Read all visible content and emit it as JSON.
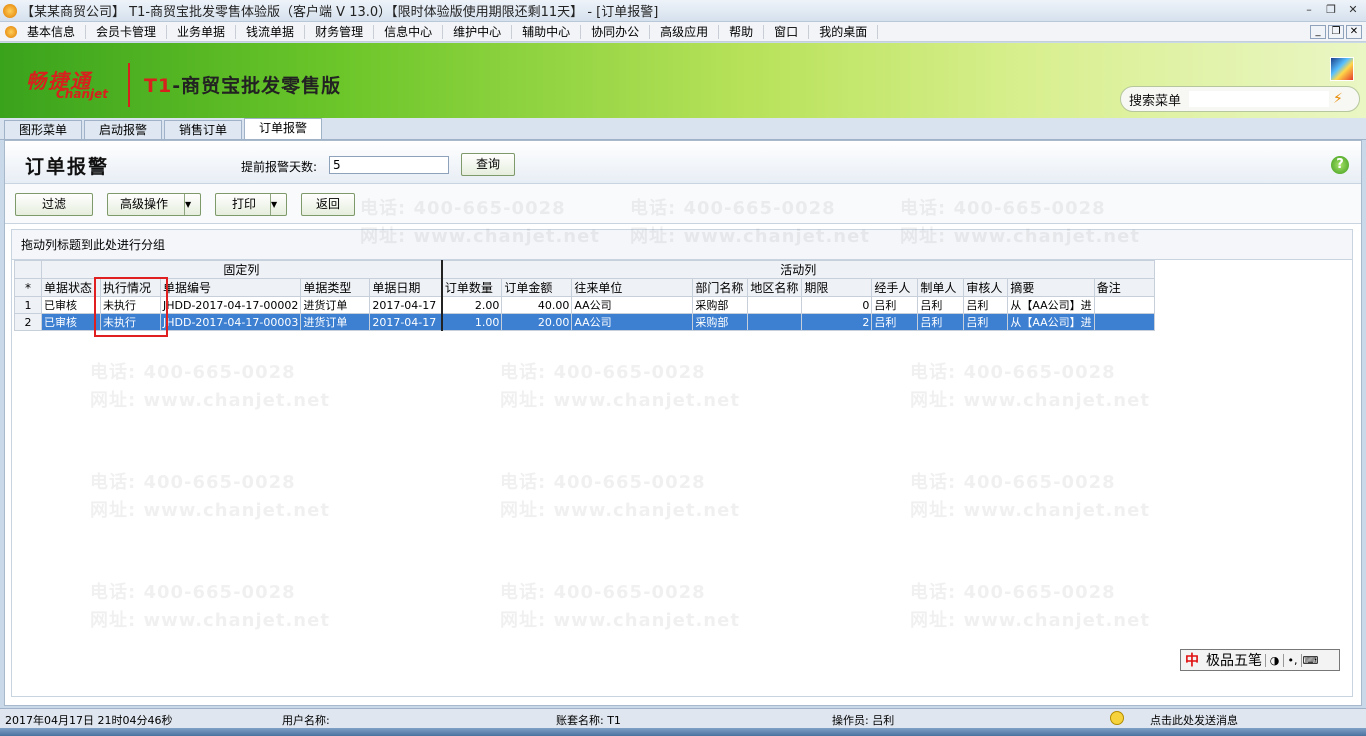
{
  "window": {
    "title": "【某某商贸公司】 T1-商贸宝批发零售体验版（客户端 V 13.0）【限时体验版使用期限还剩11天】 - [订单报警]",
    "controls": [
      "–",
      "❐",
      "✕"
    ]
  },
  "menu": [
    "基本信息",
    "会员卡管理",
    "业务单据",
    "钱流单据",
    "财务管理",
    "信息中心",
    "维护中心",
    "辅助中心",
    "协同办公",
    "高级应用",
    "帮助",
    "窗口",
    "我的桌面"
  ],
  "mdi_controls": [
    "_",
    "❐",
    "✕"
  ],
  "banner": {
    "brand_cn": "畅捷通",
    "brand_en": "Chanjet",
    "product_prefix": "T1",
    "product_rest": "-商贸宝批发零售版"
  },
  "search": {
    "label": "搜索菜单",
    "value": ""
  },
  "tabs": [
    {
      "label": "图形菜单",
      "active": false
    },
    {
      "label": "启动报警",
      "active": false
    },
    {
      "label": "销售订单",
      "active": false
    },
    {
      "label": "订单报警",
      "active": true
    }
  ],
  "page": {
    "title": "订单报警",
    "days_label": "提前报警天数:",
    "days_value": "5",
    "query_button": "查询"
  },
  "toolbar": {
    "filter": "过滤",
    "advanced": "高级操作",
    "print": "打印",
    "back": "返回"
  },
  "group_hint": "拖动列标题到此处进行分组",
  "grid": {
    "fixed_group": "固定列",
    "active_group": "活动列",
    "row_marker": "*",
    "columns": [
      "单据状态",
      "执行情况",
      "单据编号",
      "单据类型",
      "单据日期",
      "订单数量",
      "订单金额",
      "往来单位",
      "部门名称",
      "地区名称",
      "期限",
      "经手人",
      "制单人",
      "审核人",
      "摘要",
      "备注"
    ],
    "rows": [
      {
        "no": "1",
        "cells": [
          "已审核",
          "未执行",
          "JHDD-2017-04-17-00002",
          "进货订单",
          "2017-04-17",
          "2.00",
          "40.00",
          "AA公司",
          "采购部",
          "",
          "0",
          "吕利",
          "吕利",
          "吕利",
          "从【AA公司】进",
          ""
        ],
        "selected": false
      },
      {
        "no": "2",
        "cells": [
          "已审核",
          "未执行",
          "JHDD-2017-04-17-00003",
          "进货订单",
          "2017-04-17",
          "1.00",
          "20.00",
          "AA公司",
          "采购部",
          "",
          "2",
          "吕利",
          "吕利",
          "吕利",
          "从【AA公司】进",
          ""
        ],
        "selected": true
      }
    ]
  },
  "ime": {
    "logo": "中",
    "name": "极品五笔",
    "symbols": [
      "◑",
      "•,",
      "⌨"
    ]
  },
  "status": {
    "datetime": "2017年04月17日   21时04分46秒",
    "user": "用户名称:",
    "account": "账套名称: T1",
    "operator": "操作员: 吕利",
    "message": "点击此处发送消息"
  },
  "watermark": {
    "phone": "电话: 400-665-0028",
    "site": "网址: www.chanjet.net"
  },
  "colors": {
    "selected_row": "#3d7fd1",
    "highlight_box": "#e02020",
    "banner_green": "#6cc62a",
    "brand_red": "#d8201c"
  }
}
